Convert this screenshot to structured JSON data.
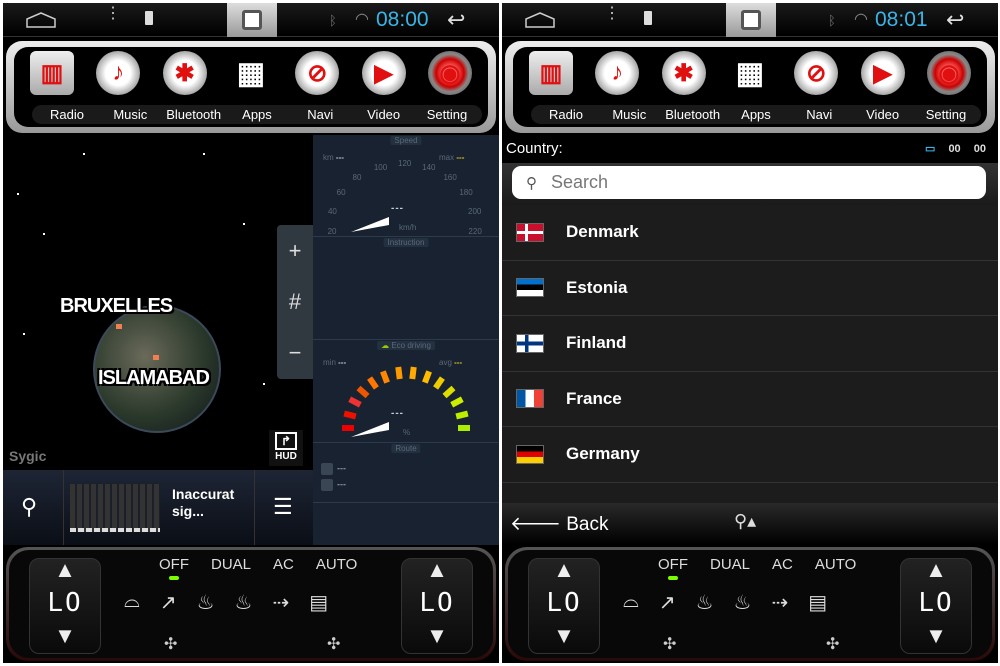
{
  "screens": [
    {
      "status": {
        "time": "08:00"
      }
    },
    {
      "status": {
        "time": "08:01"
      }
    }
  ],
  "app_bar": {
    "items": [
      {
        "label": "Radio",
        "icon": "radio-icon"
      },
      {
        "label": "Music",
        "icon": "music-note-icon"
      },
      {
        "label": "Bluetooth",
        "icon": "bluetooth-icon"
      },
      {
        "label": "Apps",
        "icon": "apps-grid-icon"
      },
      {
        "label": "Navi",
        "icon": "compass-icon"
      },
      {
        "label": "Video",
        "icon": "play-icon"
      },
      {
        "label": "Setting",
        "icon": "gear-icon"
      }
    ]
  },
  "climate": {
    "modes": [
      "OFF",
      "DUAL",
      "AC",
      "AUTO"
    ],
    "active_mode": "OFF",
    "led_color": "#7cfc00",
    "left_temp": "LO",
    "right_temp": "LO"
  },
  "map": {
    "cities": [
      "BRUXELLES",
      "ISLAMABAD"
    ],
    "zoom_in": "+",
    "zoom_out": "−",
    "logo": "Sygic",
    "hud_label": "HUD",
    "signal_status": "Inaccurat sig..."
  },
  "dashboard": {
    "speed": {
      "title": "Speed",
      "km_label": "km",
      "km_value": "---",
      "max_label": "max",
      "max_value": "---",
      "ticks": [
        "20",
        "40",
        "60",
        "80",
        "100",
        "120",
        "140",
        "160",
        "180",
        "200",
        "220"
      ],
      "value": "---",
      "unit": "km/h"
    },
    "instruction": {
      "title": "Instruction"
    },
    "eco": {
      "title": "Eco driving",
      "min_label": "min",
      "min_value": "---",
      "avg_label": "avg",
      "avg_value": "---",
      "value": "---",
      "unit": "%"
    },
    "route": {
      "title": "Route",
      "rows": [
        "---",
        "---"
      ]
    }
  },
  "country": {
    "label": "Country:",
    "time_a": "00",
    "time_b": "00",
    "search_placeholder": "Search",
    "items": [
      {
        "name": "Denmark",
        "flag": "denmark-flag"
      },
      {
        "name": "Estonia",
        "flag": "estonia-flag"
      },
      {
        "name": "Finland",
        "flag": "finland-flag"
      },
      {
        "name": "France",
        "flag": "france-flag"
      },
      {
        "name": "Germany",
        "flag": "germany-flag"
      }
    ],
    "back_label": "Back"
  },
  "colors": {
    "clock": "#39b4e6",
    "accent_red": "#e01010",
    "dash_bg": "#182230"
  }
}
